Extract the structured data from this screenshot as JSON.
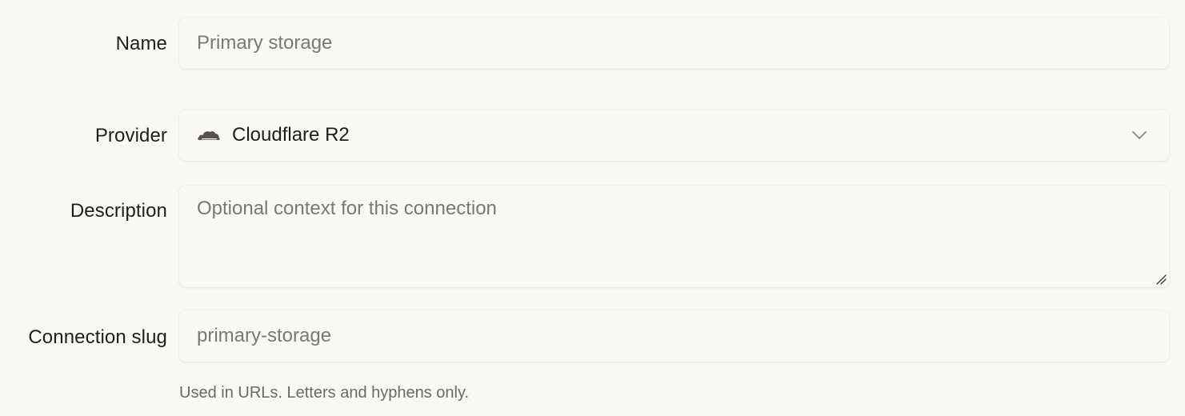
{
  "form": {
    "name": {
      "label": "Name",
      "placeholder": "Primary storage",
      "value": ""
    },
    "provider": {
      "label": "Provider",
      "selected": "Cloudflare R2",
      "icon": "cloudflare-icon"
    },
    "description": {
      "label": "Description",
      "placeholder": "Optional context for this connection",
      "value": ""
    },
    "slug": {
      "label": "Connection slug",
      "placeholder": "primary-storage",
      "value": "",
      "hint": "Used in URLs. Letters and hyphens only."
    }
  },
  "colors": {
    "background": "#faf9f5",
    "text": "#1f1e1b",
    "placeholder": "#7a7872",
    "hint": "#6b6963"
  }
}
